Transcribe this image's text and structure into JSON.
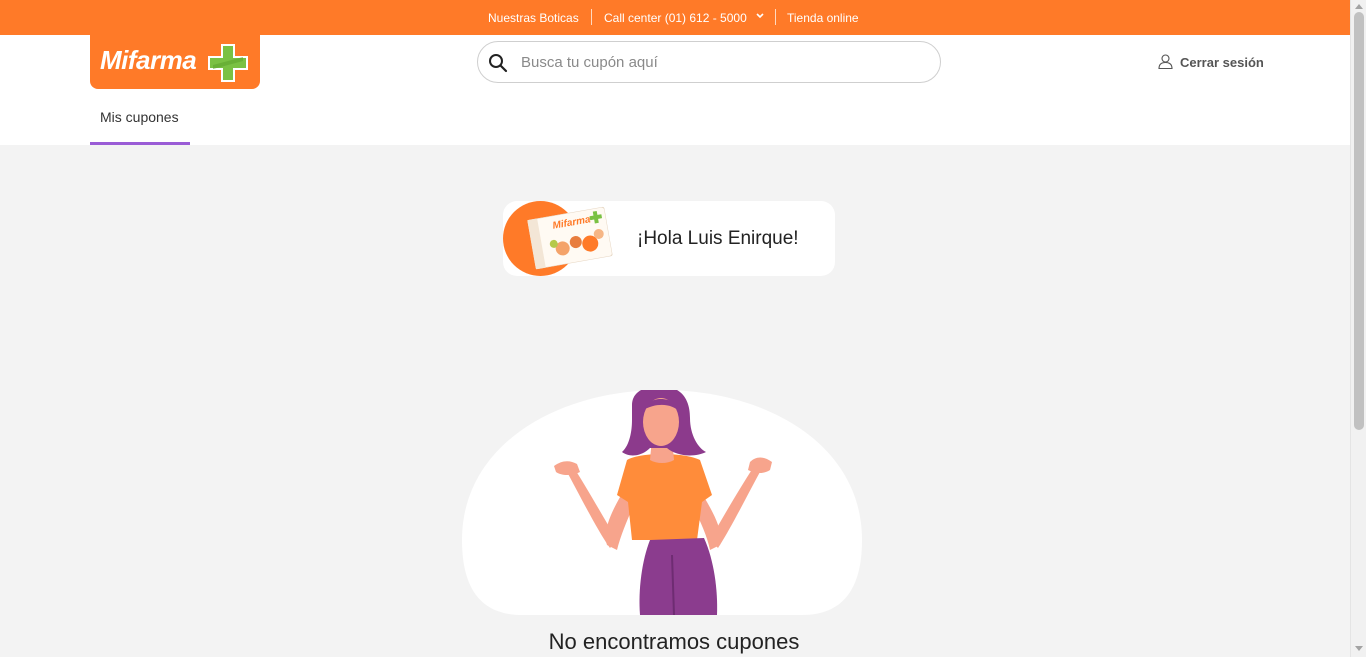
{
  "topbar": {
    "stores_label": "Nuestras Boticas",
    "callcenter_label": "Call center (01) 612 - 5000",
    "online_store_label": "Tienda online"
  },
  "header": {
    "logo_text": "Mifarma",
    "search": {
      "placeholder": "Busca tu cupón aquí",
      "value": ""
    },
    "logout_label": "Cerrar sesión"
  },
  "tabs": [
    {
      "label": "Mis cupones",
      "active": true
    }
  ],
  "greeting": {
    "text": "¡Hola Luis Enirque!"
  },
  "empty_state": {
    "title": "No encontramos cupones"
  },
  "colors": {
    "brand_orange": "#ff7a28",
    "tab_accent": "#9a5cd6",
    "brand_green": "#7ac143"
  },
  "icons": {
    "search": "search-icon",
    "user": "user-icon",
    "chevron": "chevron-down-icon"
  }
}
